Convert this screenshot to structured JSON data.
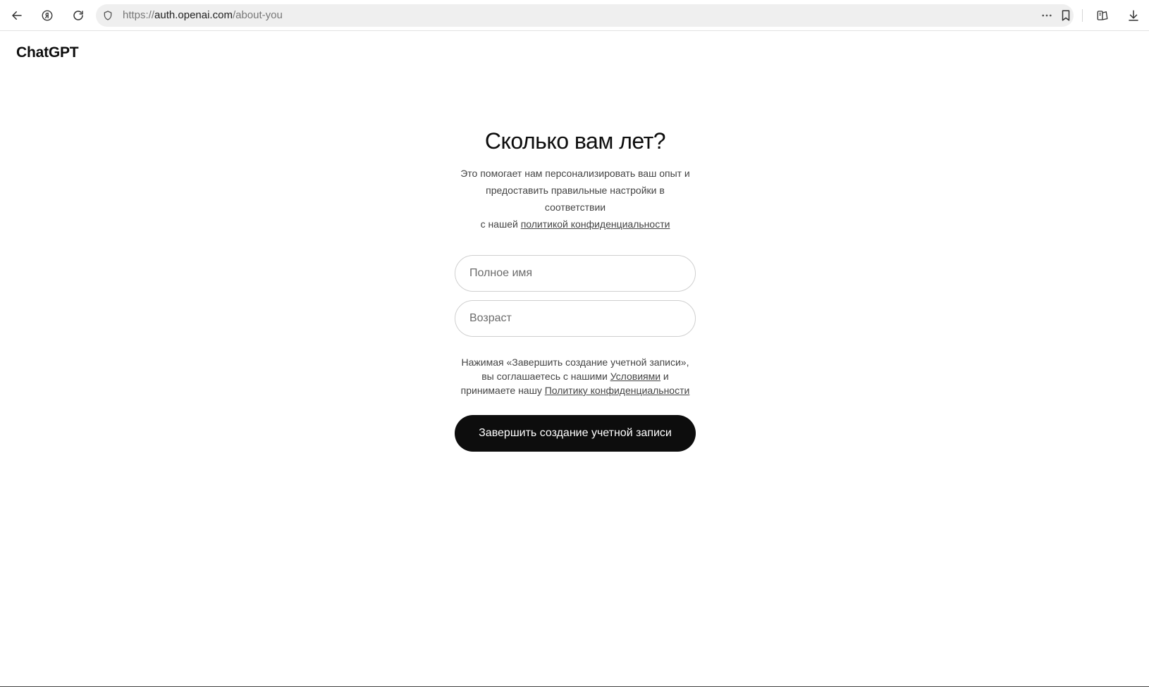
{
  "browser": {
    "url_scheme": "https://",
    "url_host": "auth.openai.com",
    "url_path": "/about-you",
    "icons": {
      "back": "arrow-left-icon",
      "yandex": "yandex-logo-icon",
      "reload": "reload-icon",
      "security": "shield-icon",
      "more": "more-horizontal-icon",
      "bookmark": "bookmark-icon",
      "collections": "collections-icon",
      "downloads": "download-icon"
    }
  },
  "page": {
    "brand": "ChatGPT",
    "heading": "Сколько вам лет?",
    "subtitle_line1": "Это помогает нам персонализировать ваш опыт и",
    "subtitle_line2": "предоставить правильные настройки в соответствии",
    "subtitle_line3_prefix": "с нашей ",
    "subtitle_link": "политикой конфиденциальности",
    "full_name": {
      "placeholder": "Полное имя",
      "value": ""
    },
    "age": {
      "placeholder": "Возраст",
      "value": ""
    },
    "terms_line1": "Нажимая «Завершить создание учетной записи»,",
    "terms_line2_prefix": "вы соглашаетесь с нашими ",
    "terms_link_terms": "Условиями",
    "terms_line2_suffix": " и",
    "terms_line3_prefix": "принимаете нашу ",
    "terms_link_privacy": "Политику конфиденциальности",
    "submit_label": "Завершить создание учетной записи"
  },
  "colors": {
    "button_bg": "#0d0d0d",
    "button_text": "#ffffff",
    "field_border": "#cfcfcf",
    "secondary_text": "#444444"
  }
}
